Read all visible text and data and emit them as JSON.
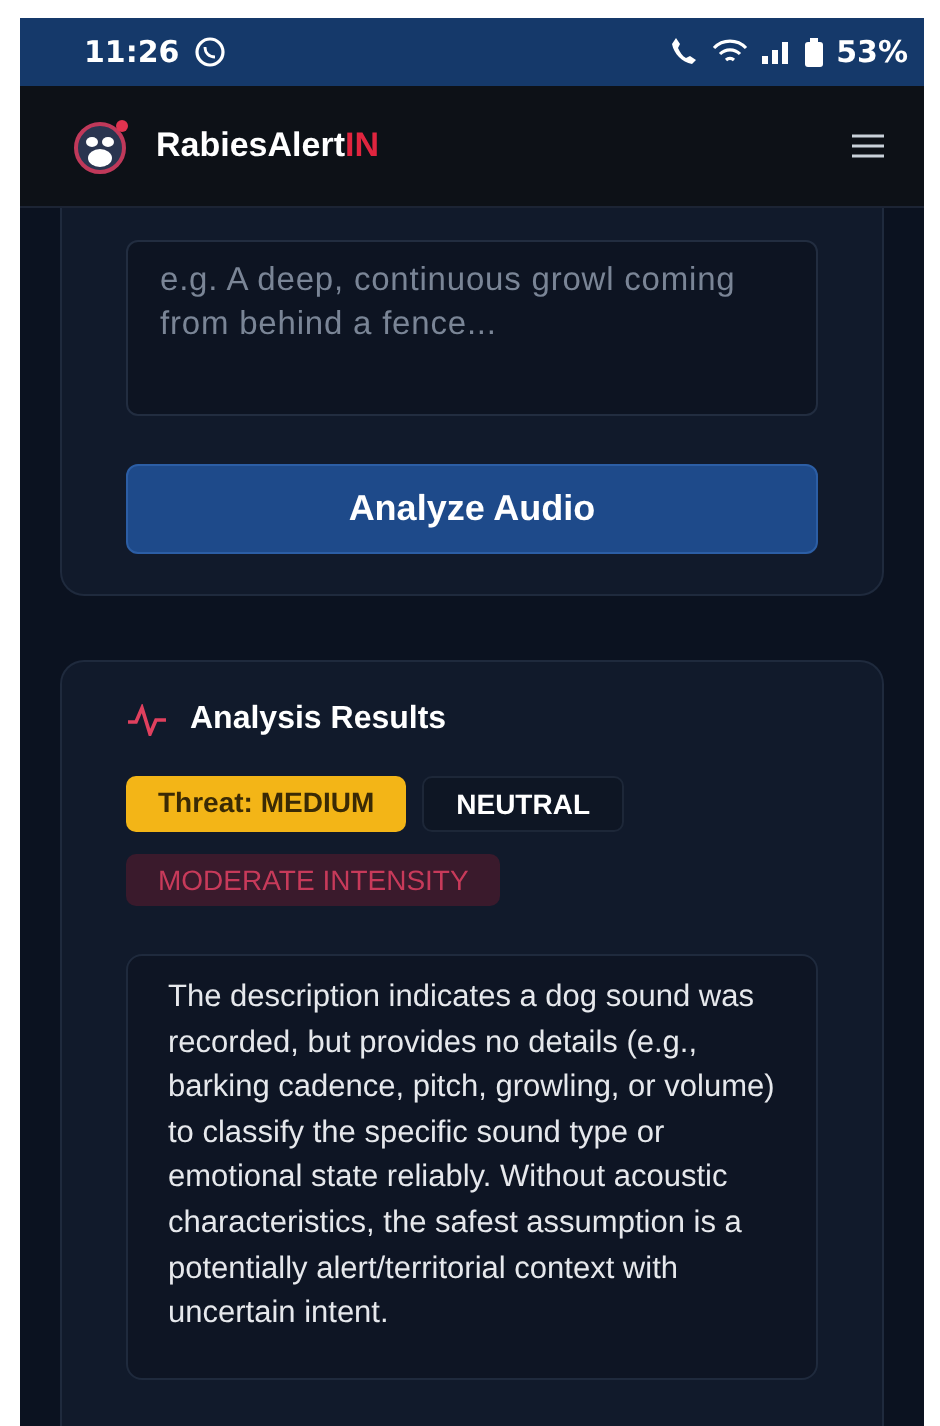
{
  "status_bar": {
    "time": "11:26",
    "battery": "53%"
  },
  "header": {
    "brand": "RabiesAlert",
    "brand_suffix": "IN"
  },
  "input_card": {
    "description_field": {
      "placeholder": "e.g. A deep, continuous growl coming from behind a fence..."
    },
    "analyze_button": "Analyze Audio"
  },
  "results_card": {
    "title": "Analysis Results",
    "badges": [
      {
        "kind": "threat",
        "label": "Threat: MEDIUM"
      },
      {
        "kind": "emotion",
        "label": "NEUTRAL"
      },
      {
        "kind": "intensity",
        "label": "MODERATE INTENSITY"
      }
    ],
    "description": "The description indicates a dog sound was recorded, but provides no details (e.g., barking cadence, pitch, growling, or volume) to classify the specific sound type or emotional state reliably. Without acoustic characteristics, the safest assumption is a potentially alert/territorial context with uncertain intent."
  }
}
